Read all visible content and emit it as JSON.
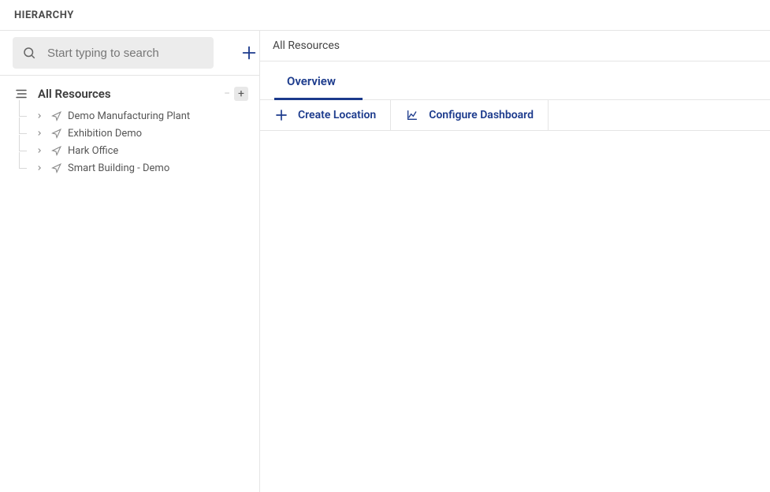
{
  "header": {
    "title": "HIERARCHY"
  },
  "sidebar": {
    "search_placeholder": "Start typing to search",
    "root_label": "All Resources",
    "items": [
      {
        "label": "Demo Manufacturing Plant"
      },
      {
        "label": "Exhibition Demo"
      },
      {
        "label": "Hark Office"
      },
      {
        "label": "Smart Building - Demo"
      }
    ]
  },
  "main": {
    "title": "All Resources",
    "tabs": [
      {
        "label": "Overview",
        "active": true
      }
    ],
    "actions": {
      "create_location": "Create Location",
      "configure_dashboard": "Configure Dashboard"
    }
  },
  "colors": {
    "accent": "#1B3A8C"
  }
}
